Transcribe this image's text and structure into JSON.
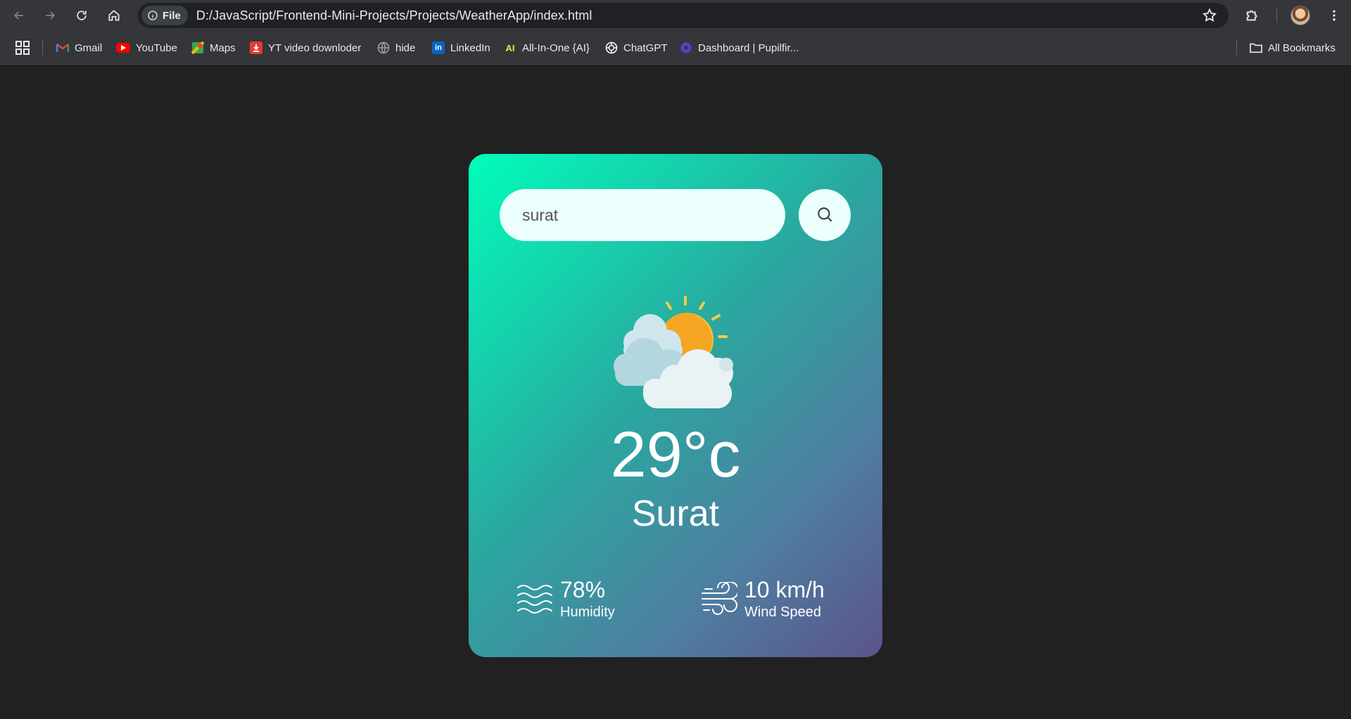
{
  "browser": {
    "chip_label": "File",
    "url": "D:/JavaScript/Frontend-Mini-Projects/Projects/WeatherApp/index.html",
    "bookmarks": [
      {
        "label": "Gmail",
        "icon": "gmail-icon",
        "color": "#ea4335"
      },
      {
        "label": "YouTube",
        "icon": "youtube-icon",
        "color": "#ff0000"
      },
      {
        "label": "Maps",
        "icon": "maps-icon",
        "color": "#34a853"
      },
      {
        "label": "YT video downloder",
        "icon": "download-icon",
        "color": "#e53935"
      },
      {
        "label": "hide",
        "icon": "globe-icon",
        "color": "#9aa0a6"
      },
      {
        "label": "LinkedIn",
        "icon": "linkedin-icon",
        "color": "#0a66c2"
      },
      {
        "label": "All-In-One {AI}",
        "icon": "ai-icon",
        "color": "#e5e54a"
      },
      {
        "label": "ChatGPT",
        "icon": "chatgpt-icon",
        "color": "#ffffff"
      },
      {
        "label": "Dashboard | Pupilfir...",
        "icon": "dashboard-icon",
        "color": "#5b3fd1"
      }
    ],
    "all_bookmarks_label": "All Bookmarks"
  },
  "weather": {
    "search_value": "surat",
    "temperature": "29°c",
    "city": "Surat",
    "humidity_value": "78%",
    "humidity_label": "Humidity",
    "wind_value": "10 km/h",
    "wind_label": "Wind Speed",
    "condition_icon": "partly-cloudy-icon"
  },
  "colors": {
    "card_gradient_start": "#00feba",
    "card_gradient_end": "#5b548a",
    "page_background": "#212121"
  }
}
